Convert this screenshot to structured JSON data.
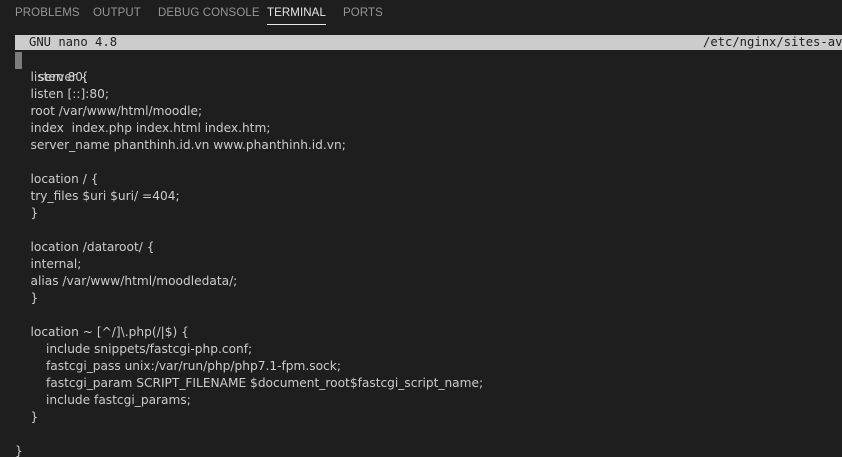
{
  "panel": {
    "tabs": [
      {
        "label": "PROBLEMS"
      },
      {
        "label": "OUTPUT"
      },
      {
        "label": "DEBUG CONSOLE"
      },
      {
        "label": "TERMINAL"
      },
      {
        "label": "PORTS"
      }
    ],
    "active_tab": "TERMINAL"
  },
  "nano": {
    "version": "GNU nano 4.8",
    "filename": "/etc/nginx/sites-ava"
  },
  "editor": {
    "lines": [
      "server {",
      "    listen 80;",
      "    listen [::]:80;",
      "    root /var/www/html/moodle;",
      "    index  index.php index.html index.htm;",
      "    server_name phanthinh.id.vn www.phanthinh.id.vn;",
      "",
      "    location / {",
      "    try_files $uri $uri/ =404;",
      "    }",
      "",
      "    location /dataroot/ {",
      "    internal;",
      "    alias /var/www/html/moodledata/;",
      "    }",
      "",
      "    location ~ [^/]\\.php(/|$) {",
      "        include snippets/fastcgi-php.conf;",
      "        fastcgi_pass unix:/var/run/php/php7.1-fpm.sock;",
      "        fastcgi_param SCRIPT_FILENAME $document_root$fastcgi_script_name;",
      "        include fastcgi_params;",
      "    }",
      "",
      "}"
    ]
  }
}
